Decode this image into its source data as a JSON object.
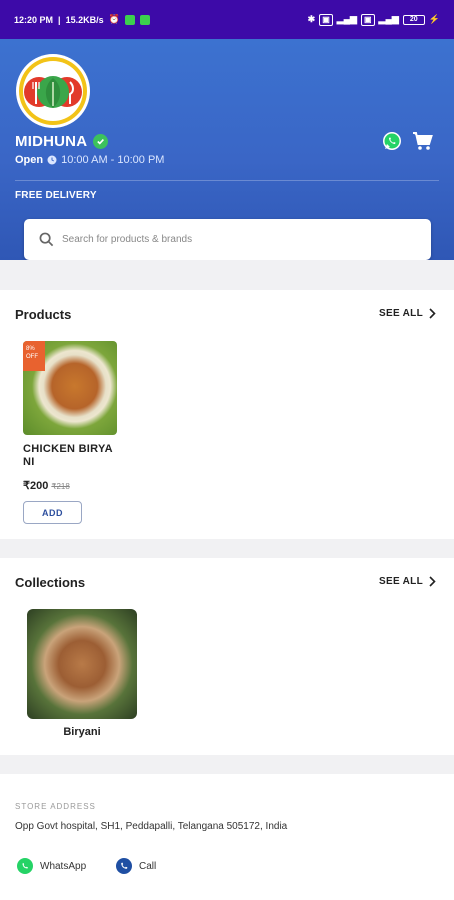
{
  "status_bar": {
    "time": "12:20 PM",
    "speed": "15.2KB/s",
    "battery": "20"
  },
  "store": {
    "name": "MIDHUNA",
    "open_label": "Open",
    "hours": "10:00 AM - 10:00 PM",
    "delivery": "FREE DELIVERY"
  },
  "search": {
    "placeholder": "Search for products & brands"
  },
  "products_section": {
    "title": "Products",
    "see_all": "SEE ALL",
    "items": [
      {
        "badge_line1": "8%",
        "badge_line2": "OFF",
        "name": "CHICKEN BIRYANI",
        "price": "₹200",
        "mrp": "₹218",
        "add_label": "ADD"
      }
    ]
  },
  "collections_section": {
    "title": "Collections",
    "see_all": "SEE ALL",
    "items": [
      {
        "label": "Biryani"
      }
    ]
  },
  "address": {
    "heading": "STORE ADDRESS",
    "text": "Opp Govt hospital, SH1, Peddapalli, Telangana 505172, India"
  },
  "contacts": {
    "whatsapp": "WhatsApp",
    "call": "Call"
  },
  "colors": {
    "status_bar": "#3d0aa8",
    "header": "#3a66c6",
    "whatsapp": "#25d366",
    "call": "#1f4fa3"
  }
}
